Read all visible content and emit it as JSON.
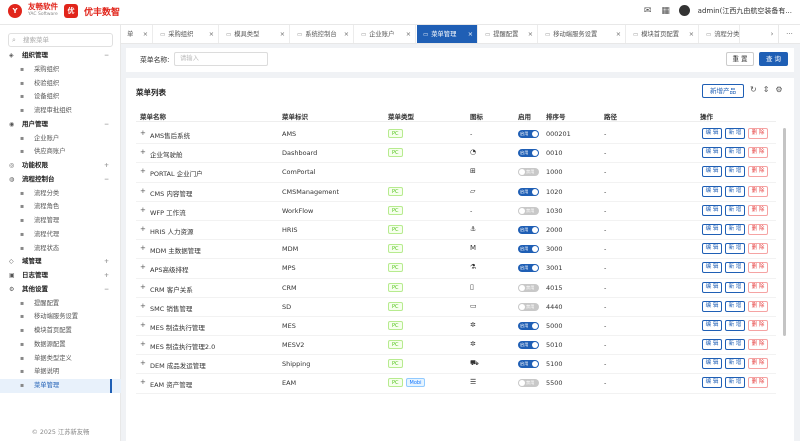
{
  "header": {
    "logo1_cn": "友畅软件",
    "logo1_en": "YAC Software",
    "logo2_cn": "优丰数智",
    "user": "admin(江西九由航空装备有..."
  },
  "sidebar": {
    "search_placeholder": "搜索菜单",
    "groups": [
      {
        "label": "组织管理",
        "items": [
          "采购组织",
          "校验组织",
          "设备组织",
          "流程审批组织"
        ]
      },
      {
        "label": "用户管理",
        "items": [
          "企业账户",
          "供应商账户"
        ]
      },
      {
        "label": "功能权限",
        "items": []
      },
      {
        "label": "流程控制台",
        "items": [
          "流程分类",
          "流程角色",
          "流程管理",
          "流程代理",
          "流程状态"
        ]
      },
      {
        "label": "域管理",
        "items": []
      },
      {
        "label": "日志管理",
        "items": []
      },
      {
        "label": "其他设置",
        "items": [
          "提醒配置",
          "移动端服务设置",
          "模块首页配置",
          "数据源配置",
          "单据类型定义",
          "单据说明",
          "菜单管理"
        ]
      }
    ],
    "active_item": "菜单管理",
    "copyright": "© 2025 江苏新友畅"
  },
  "tabs": [
    {
      "label": "单",
      "active": false
    },
    {
      "label": "采购组织",
      "active": false
    },
    {
      "label": "模具类型",
      "active": false
    },
    {
      "label": "系统控制台",
      "active": false
    },
    {
      "label": "企业账户",
      "active": false
    },
    {
      "label": "菜单管理",
      "active": true
    },
    {
      "label": "提醒配置",
      "active": false
    },
    {
      "label": "移动端服务设置",
      "active": false
    },
    {
      "label": "模块首页配置",
      "active": false
    },
    {
      "label": "流程分类",
      "active": false
    }
  ],
  "filter": {
    "label": "菜单名称:",
    "placeholder": "请输入",
    "reset": "重 置",
    "query": "查 询"
  },
  "table": {
    "title": "菜单列表",
    "add_button": "新增产品",
    "columns": [
      "菜单名称",
      "菜单标识",
      "菜单类型",
      "图标",
      "启用",
      "排序号",
      "路径",
      "操作"
    ],
    "switch_on": "启用",
    "switch_off": "禁用",
    "op_edit": "编 辑",
    "op_add": "新 增",
    "op_delete": "删 除",
    "rows": [
      {
        "name": "AMS售后系统",
        "key": "AMS",
        "type": [
          "PC"
        ],
        "icon": "-",
        "enabled": true,
        "order": "000201",
        "path": "-"
      },
      {
        "name": "企业驾驶舱",
        "key": "Dashboard",
        "type": [
          "PC"
        ],
        "icon": "dashboard-icon",
        "enabled": true,
        "order": "0010",
        "path": "-"
      },
      {
        "name": "PORTAL 企业门户",
        "key": "ComPortal",
        "type": [],
        "icon": "portal-icon",
        "enabled": false,
        "order": "1000",
        "path": "-"
      },
      {
        "name": "CMS 内容管理",
        "key": "CMSManagement",
        "type": [
          "PC"
        ],
        "icon": "note-icon",
        "enabled": true,
        "order": "1020",
        "path": "-"
      },
      {
        "name": "WFP 工作流",
        "key": "WorkFlow",
        "type": [
          "PC"
        ],
        "icon": "-",
        "enabled": false,
        "order": "1030",
        "path": "-"
      },
      {
        "name": "HRIS 人力资源",
        "key": "HRIS",
        "type": [
          "PC"
        ],
        "icon": "anchor-icon",
        "enabled": true,
        "order": "2000",
        "path": "-"
      },
      {
        "name": "MDM 主数据管理",
        "key": "MDM",
        "type": [
          "PC"
        ],
        "icon": "mdm-icon",
        "enabled": true,
        "order": "3000",
        "path": "-"
      },
      {
        "name": "APS高级排程",
        "key": "MPS",
        "type": [
          "PC"
        ],
        "icon": "flask-icon",
        "enabled": true,
        "order": "3001",
        "path": "-"
      },
      {
        "name": "CRM 客户关系",
        "key": "CRM",
        "type": [
          "PC"
        ],
        "icon": "book-icon",
        "enabled": false,
        "order": "4015",
        "path": "-"
      },
      {
        "name": "SMC 销售管理",
        "key": "SD",
        "type": [
          "PC"
        ],
        "icon": "briefcase-icon",
        "enabled": false,
        "order": "4440",
        "path": "-"
      },
      {
        "name": "MES 制造执行管理",
        "key": "MES",
        "type": [
          "PC"
        ],
        "icon": "gear-icon",
        "enabled": true,
        "order": "5000",
        "path": "-"
      },
      {
        "name": "MES 制造执行管理2.0",
        "key": "MESV2",
        "type": [
          "PC"
        ],
        "icon": "gear-icon",
        "enabled": true,
        "order": "5010",
        "path": "-"
      },
      {
        "name": "DEM 成品发运管理",
        "key": "Shipping",
        "type": [
          "PC"
        ],
        "icon": "truck-icon",
        "enabled": true,
        "order": "5100",
        "path": "-"
      },
      {
        "name": "EAM 资产管理",
        "key": "EAM",
        "type": [
          "PC",
          "Mobi"
        ],
        "icon": "list-icon",
        "enabled": false,
        "order": "5500",
        "path": "-"
      }
    ]
  },
  "colors": {
    "primary": "#1f5fb5",
    "brand_red": "#e1251b",
    "success": "#52c41a",
    "danger": "#e64545"
  }
}
